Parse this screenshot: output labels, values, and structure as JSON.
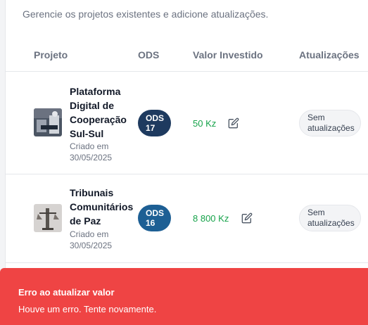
{
  "header": {
    "subtitle": "Gerencie os projetos existentes e adicione atualizações."
  },
  "table": {
    "columns": [
      "Projeto",
      "ODS",
      "Valor Investido",
      "Atualizações"
    ],
    "rows": [
      {
        "name_lines": [
          "Plataforma",
          "Digital de",
          "Cooperação",
          "Sul-Sul"
        ],
        "created_lines": [
          "Criado em",
          "30/05/2025"
        ],
        "ods_lines": [
          "ODS",
          "17"
        ],
        "value": "50 Kz",
        "updates_lines": [
          "Sem",
          "atualizações"
        ]
      },
      {
        "name_lines": [
          "Tribunais",
          "Comunitários",
          "de Paz"
        ],
        "created_lines": [
          "Criado em",
          "30/05/2025"
        ],
        "ods_lines": [
          "ODS",
          "16"
        ],
        "value": "8 800 Kz",
        "updates_lines": [
          "Sem",
          "atualizações"
        ]
      }
    ]
  },
  "toast": {
    "title": "Erro ao atualizar valor",
    "message": "Houve um erro. Tente novamente."
  },
  "colors": {
    "ods_17": "#1e3a5f",
    "ods_16": "#1d5f94",
    "value_green": "#16a34a",
    "toast_red": "#ef4444"
  },
  "icons": [
    "edit-icon"
  ]
}
